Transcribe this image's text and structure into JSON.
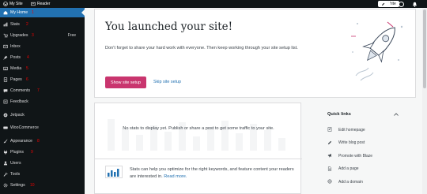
{
  "topbar": {
    "my_site": "My Site",
    "reader": "Reader",
    "write": "Write"
  },
  "sidebar": {
    "items": [
      {
        "label": "My Home",
        "num": "1",
        "icon": "home-icon",
        "active": true
      },
      {
        "label": "Stats",
        "num": "2",
        "icon": "stats-icon"
      },
      {
        "label": "Upgrades",
        "num": "3",
        "icon": "cart-icon",
        "badge": "Free"
      },
      {
        "label": "Inbox",
        "num": "",
        "icon": "mail-icon"
      },
      {
        "label": "Posts",
        "num": "4",
        "icon": "pin-icon"
      },
      {
        "label": "Media",
        "num": "5",
        "icon": "media-icon"
      },
      {
        "label": "Pages",
        "num": "6",
        "icon": "pages-icon"
      },
      {
        "label": "Comments",
        "num": "7",
        "icon": "comment-icon"
      },
      {
        "label": "Feedback",
        "num": "",
        "icon": "feedback-icon"
      },
      {
        "label": "Jetpack",
        "num": "",
        "icon": "jetpack-icon"
      },
      {
        "label": "WooCommerce",
        "num": "",
        "icon": "woo-icon"
      },
      {
        "label": "Appearance",
        "num": "8",
        "icon": "brush-icon"
      },
      {
        "label": "Plugins",
        "num": "9",
        "icon": "plugin-icon"
      },
      {
        "label": "Users",
        "num": "",
        "icon": "users-icon"
      },
      {
        "label": "Tools",
        "num": "",
        "icon": "wrench-icon"
      },
      {
        "label": "Settings",
        "num": "10",
        "icon": "settings-icon"
      }
    ]
  },
  "launch": {
    "title": "You launched your site!",
    "description": "Don't forget to share your hard work with everyone. Then keep working through your site setup list.",
    "primary_button": "Show site setup",
    "secondary_link": "Skip site setup"
  },
  "stats": {
    "empty_message": "No stats to display yet. Publish or share a post to get some traffic to your site.",
    "promo_text": "Stats can help you optimize for the right keywords, and feature content your readers are interested in.",
    "promo_link": "Read more."
  },
  "quick_links": {
    "title": "Quick links",
    "items": [
      {
        "label": "Edit homepage",
        "icon": "page-edit-icon"
      },
      {
        "label": "Write blog post",
        "icon": "pencil-icon"
      },
      {
        "label": "Promote with Blaze",
        "icon": "megaphone-icon"
      },
      {
        "label": "Add a page",
        "icon": "add-page-icon"
      },
      {
        "label": "Add a domain",
        "icon": "globe-icon"
      }
    ]
  },
  "colors": {
    "sidebar_bg": "#101517",
    "active_nav": "#2271b1",
    "primary_button": "#c9356e",
    "link": "#2271b1",
    "annotation_numbers": "#ee0000"
  }
}
